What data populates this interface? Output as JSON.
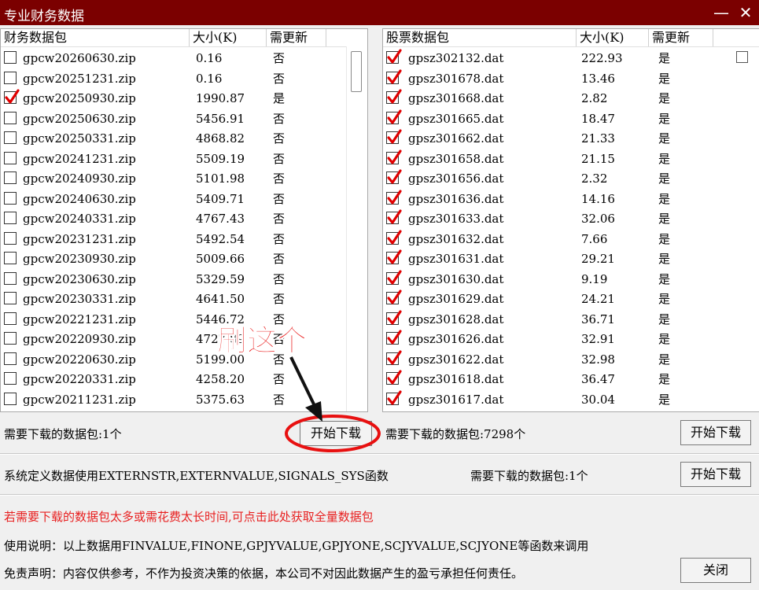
{
  "window": {
    "title": "专业财务数据",
    "minimize": "—",
    "close": "✕"
  },
  "finance_panel": {
    "headers": [
      "财务数据包",
      "大小(K)",
      "需更新"
    ],
    "rows": [
      {
        "name": "gpcw20260630.zip",
        "size": "0.16",
        "update": "否",
        "checked": false
      },
      {
        "name": "gpcw20251231.zip",
        "size": "0.16",
        "update": "否",
        "checked": false
      },
      {
        "name": "gpcw20250930.zip",
        "size": "1990.87",
        "update": "是",
        "checked": true
      },
      {
        "name": "gpcw20250630.zip",
        "size": "5456.91",
        "update": "否",
        "checked": false
      },
      {
        "name": "gpcw20250331.zip",
        "size": "4868.82",
        "update": "否",
        "checked": false
      },
      {
        "name": "gpcw20241231.zip",
        "size": "5509.19",
        "update": "否",
        "checked": false
      },
      {
        "name": "gpcw20240930.zip",
        "size": "5101.98",
        "update": "否",
        "checked": false
      },
      {
        "name": "gpcw20240630.zip",
        "size": "5409.71",
        "update": "否",
        "checked": false
      },
      {
        "name": "gpcw20240331.zip",
        "size": "4767.43",
        "update": "否",
        "checked": false
      },
      {
        "name": "gpcw20231231.zip",
        "size": "5492.54",
        "update": "否",
        "checked": false
      },
      {
        "name": "gpcw20230930.zip",
        "size": "5009.66",
        "update": "否",
        "checked": false
      },
      {
        "name": "gpcw20230630.zip",
        "size": "5329.59",
        "update": "否",
        "checked": false
      },
      {
        "name": "gpcw20230331.zip",
        "size": "4641.50",
        "update": "否",
        "checked": false
      },
      {
        "name": "gpcw20221231.zip",
        "size": "5446.72",
        "update": "否",
        "checked": false
      },
      {
        "name": "gpcw20220930.zip",
        "size": "4727.89",
        "update": "否",
        "checked": false
      },
      {
        "name": "gpcw20220630.zip",
        "size": "5199.00",
        "update": "否",
        "checked": false
      },
      {
        "name": "gpcw20220331.zip",
        "size": "4258.20",
        "update": "否",
        "checked": false
      },
      {
        "name": "gpcw20211231.zip",
        "size": "5375.63",
        "update": "否",
        "checked": false
      }
    ]
  },
  "stock_panel": {
    "headers": [
      "股票数据包",
      "大小(K)",
      "需更新"
    ],
    "rows": [
      {
        "name": "gpsz302132.dat",
        "size": "222.93",
        "update": "是",
        "checked": true
      },
      {
        "name": "gpsz301678.dat",
        "size": "13.46",
        "update": "是",
        "checked": true
      },
      {
        "name": "gpsz301668.dat",
        "size": "2.82",
        "update": "是",
        "checked": true
      },
      {
        "name": "gpsz301665.dat",
        "size": "18.47",
        "update": "是",
        "checked": true
      },
      {
        "name": "gpsz301662.dat",
        "size": "21.33",
        "update": "是",
        "checked": true
      },
      {
        "name": "gpsz301658.dat",
        "size": "21.15",
        "update": "是",
        "checked": true
      },
      {
        "name": "gpsz301656.dat",
        "size": "2.32",
        "update": "是",
        "checked": true
      },
      {
        "name": "gpsz301636.dat",
        "size": "14.16",
        "update": "是",
        "checked": true
      },
      {
        "name": "gpsz301633.dat",
        "size": "32.06",
        "update": "是",
        "checked": true
      },
      {
        "name": "gpsz301632.dat",
        "size": "7.66",
        "update": "是",
        "checked": true
      },
      {
        "name": "gpsz301631.dat",
        "size": "29.21",
        "update": "是",
        "checked": true
      },
      {
        "name": "gpsz301630.dat",
        "size": "9.19",
        "update": "是",
        "checked": true
      },
      {
        "name": "gpsz301629.dat",
        "size": "24.21",
        "update": "是",
        "checked": true
      },
      {
        "name": "gpsz301628.dat",
        "size": "36.71",
        "update": "是",
        "checked": true
      },
      {
        "name": "gpsz301626.dat",
        "size": "32.91",
        "update": "是",
        "checked": true
      },
      {
        "name": "gpsz301622.dat",
        "size": "32.98",
        "update": "是",
        "checked": true
      },
      {
        "name": "gpsz301618.dat",
        "size": "36.47",
        "update": "是",
        "checked": true
      },
      {
        "name": "gpsz301617.dat",
        "size": "30.04",
        "update": "是",
        "checked": true
      }
    ]
  },
  "finance_need": "需要下载的数据包:1个",
  "finance_download": "开始下载",
  "stock_need": "需要下载的数据包:7298个",
  "stock_download": "开始下载",
  "system_text": "系统定义数据使用EXTERNSTR,EXTERNVALUE,SIGNALS_SYS函数",
  "system_need": "需要下载的数据包:1个",
  "system_download": "开始下载",
  "full_package_link": "若需要下载的数据包太多或需花费太长时间,可点击此处获取全量数据包",
  "usage": "使用说明：以上数据用FINVALUE,FINONE,GPJYVALUE,GPJYONE,SCJYVALUE,SCJYONE等函数来调用",
  "disclaimer": "免责声明：内容仅供参考，不作为投资决策的依据，本公司不对因此数据产生的盈亏承担任何责任。",
  "close_button": "关闭",
  "annotation": "刷这个",
  "colors": {
    "title_bar": "#7b0000",
    "link_red": "#e82020",
    "annotation_red": "#e81010",
    "check_red": "#e00000"
  }
}
